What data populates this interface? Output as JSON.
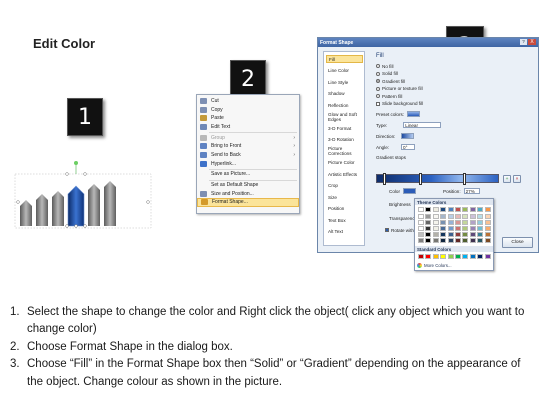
{
  "title": "Edit Color",
  "badges": [
    "1",
    "2",
    "3"
  ],
  "context_menu": {
    "items": [
      {
        "label": "Cut",
        "u": "t",
        "icon": "scissors-icon",
        "color": "#7d8fb3",
        "dim": false,
        "arrow": false
      },
      {
        "label": "Copy",
        "u": "C",
        "icon": "copy-icon",
        "color": "#7d8fb3",
        "dim": false,
        "arrow": false
      },
      {
        "label": "Paste",
        "u": "P",
        "icon": "paste-icon",
        "color": "#c49a3a",
        "dim": false,
        "arrow": false
      },
      {
        "label": "Edit Text",
        "u": "x",
        "icon": "edit-text-icon",
        "color": "#6f88b6",
        "dim": false,
        "arrow": false
      },
      {
        "label": "Group",
        "u": "G",
        "icon": "group-icon",
        "color": "#b8b8b8",
        "dim": true,
        "arrow": true
      },
      {
        "label": "Bring to Front",
        "u": "r",
        "icon": "bring-front-icon",
        "color": "#5e82c2",
        "dim": false,
        "arrow": true
      },
      {
        "label": "Send to Back",
        "u": "k",
        "icon": "send-back-icon",
        "color": "#5e82c2",
        "dim": false,
        "arrow": true
      },
      {
        "label": "Hyperlink...",
        "u": "H",
        "icon": "hyperlink-icon",
        "color": "#3e72c9",
        "dim": false,
        "arrow": false
      },
      {
        "label": "Save as Picture...",
        "u": "S",
        "icon": "",
        "color": "",
        "dim": false,
        "arrow": false
      },
      {
        "label": "Set as Default Shape",
        "u": "D",
        "icon": "",
        "color": "",
        "dim": false,
        "arrow": false
      },
      {
        "label": "Size and Position...",
        "u": "z",
        "icon": "size-icon",
        "color": "#7d8fb3",
        "dim": false,
        "arrow": false
      },
      {
        "label": "Format Shape...",
        "u": "o",
        "icon": "format-shape-icon",
        "color": "#d49a2a",
        "dim": false,
        "arrow": false
      }
    ]
  },
  "dialog": {
    "title": "Format Shape",
    "help": "?",
    "close": "X",
    "nav": [
      "Fill",
      "Line Color",
      "Line Style",
      "Shadow",
      "Reflection",
      "Glow and Soft Edges",
      "3-D Format",
      "3-D Rotation",
      "Picture Corrections",
      "Picture Color",
      "Artistic Effects",
      "Crop",
      "Size",
      "Position",
      "Text Box",
      "Alt Text"
    ],
    "fill_heading": "Fill",
    "fill_options": [
      {
        "label": "No fill",
        "on": false
      },
      {
        "label": "Solid fill",
        "on": false
      },
      {
        "label": "Gradient fill",
        "on": true
      },
      {
        "label": "Picture or texture fill",
        "on": false
      },
      {
        "label": "Pattern fill",
        "on": false
      }
    ],
    "slide_bg_label": "Slide background fill",
    "preset_label": "Preset colors:",
    "type_label": "Type:",
    "type_value": "Linear",
    "direction_label": "Direction:",
    "angle_label": "Angle:",
    "angle_value": "0°",
    "gradient_stops_label": "Gradient stops",
    "color_label": "Color",
    "position_label": "Position:",
    "position_value": "27%",
    "brightness_label": "Brightness",
    "transparency_label": "Transparency",
    "rotate_label": "Rotate with shape",
    "close_button": "Close"
  },
  "color_popup": {
    "theme_label": "Theme Colors",
    "standard_label": "Standard Colors",
    "more_label": "More Colors...",
    "theme_top": [
      "#ffffff",
      "#000000",
      "#eeece1",
      "#1f497d",
      "#4f81bd",
      "#c0504d",
      "#9bbb59",
      "#8064a2",
      "#4bacc6",
      "#f79646"
    ],
    "standard": [
      "#c00000",
      "#ff0000",
      "#ffc000",
      "#ffff00",
      "#92d050",
      "#00b050",
      "#00b0f0",
      "#0070c0",
      "#002060",
      "#7030a0"
    ]
  },
  "instructions": [
    {
      "num": "1.",
      "text": "Select the shape to change the color and Right click the object( click any object which you want to change color)"
    },
    {
      "num": "2.",
      "text": "Choose Format Shape in the dialog box."
    },
    {
      "num": "3.",
      "text": "Choose “Fill” in the Format Shape box then “Solid” or “Gradient” depending on the appearance of the object. Change colour as shown in the picture."
    }
  ]
}
